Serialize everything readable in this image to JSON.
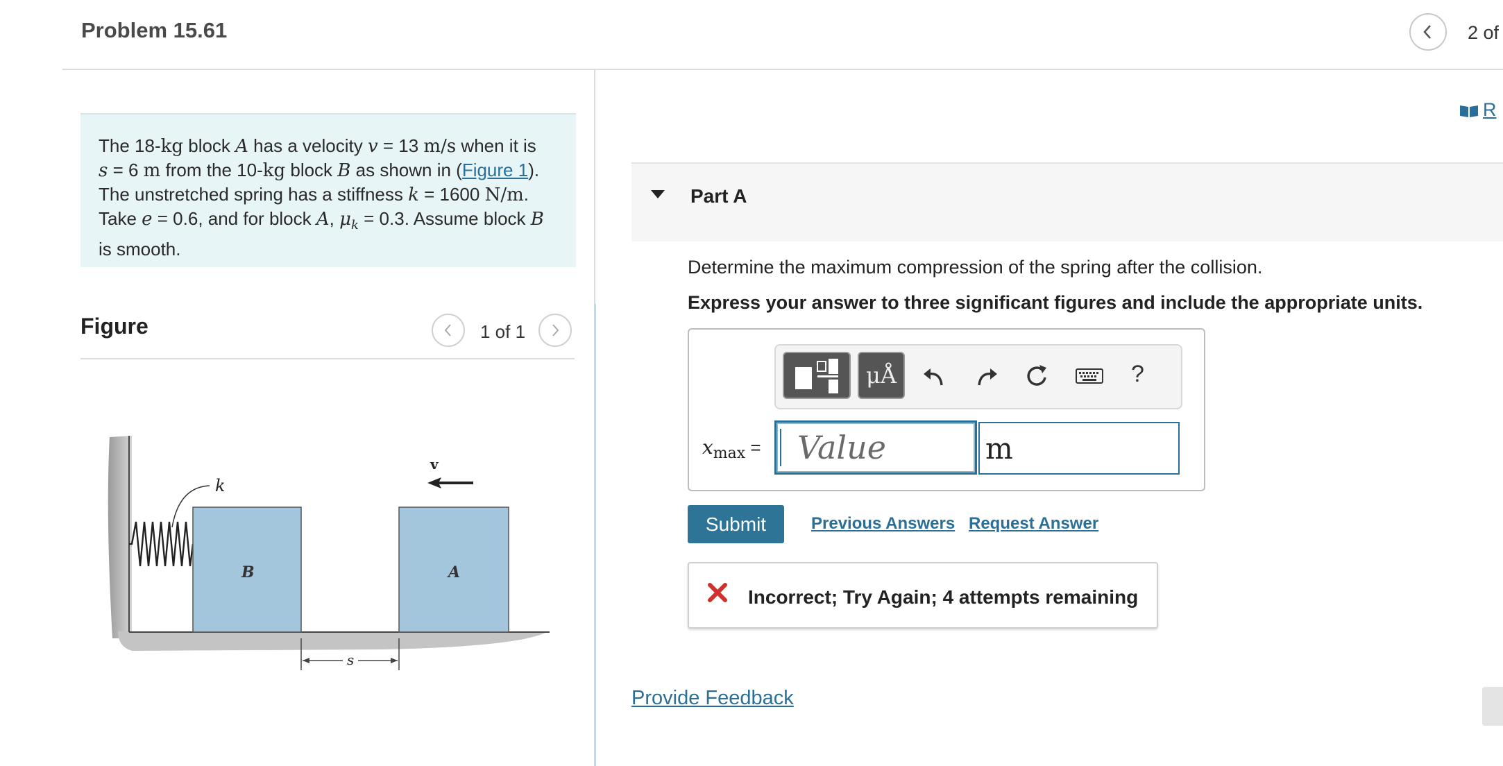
{
  "header": {
    "title": "Problem 15.61",
    "nav_count": "2 of",
    "review_label": "R"
  },
  "problem": {
    "line1": [
      "The 18-",
      "kg",
      " block ",
      "A",
      " has a velocity ",
      "v",
      " = 13 ",
      "m/s",
      " when it is"
    ],
    "line2": [
      "s",
      " = 6 ",
      "m",
      " from the 10-",
      "kg",
      " block ",
      "B",
      " as shown in (",
      "Figure 1",
      ")."
    ],
    "line3": [
      "The unstretched spring has a stiffness ",
      "k",
      " = 1600 ",
      "N/m",
      "."
    ],
    "line4": [
      "Take ",
      "e",
      " = 0.6, and for block ",
      "A",
      ", ",
      "μ",
      "k",
      " = 0.3. Assume block ",
      "B"
    ],
    "line5": "is smooth."
  },
  "figure": {
    "title": "Figure",
    "count": "1 of 1",
    "labels": {
      "k": "k",
      "B": "B",
      "A": "A",
      "v": "v",
      "s": "s"
    }
  },
  "partA": {
    "label": "Part A",
    "question": "Determine the maximum compression of the spring after the collision.",
    "instruction": "Express your answer to three significant figures and include the appropriate units.",
    "var_main": "x",
    "var_sub": "max",
    "var_eq": " =",
    "value_placeholder": "Value",
    "unit_value": "m",
    "toolbar": {
      "units_label": "μÅ",
      "help_label": "?"
    },
    "submit_label": "Submit",
    "previous_answers": "Previous Answers",
    "request_answer": "Request Answer",
    "feedback_text": "Incorrect; Try Again; 4 attempts remaining"
  },
  "footer": {
    "provide_feedback": "Provide Feedback"
  },
  "colors": {
    "link": "#2a6f97",
    "submit_bg": "#2d7497",
    "problem_bg": "#e8f5f7",
    "block_fill": "#a3c6dc",
    "error_red": "#d0312d"
  },
  "icons": [
    "chevron-left-icon",
    "book-icon",
    "caret-down-icon",
    "templates-icon",
    "undo-icon",
    "redo-icon",
    "reset-icon",
    "keyboard-icon",
    "error-x-icon"
  ]
}
